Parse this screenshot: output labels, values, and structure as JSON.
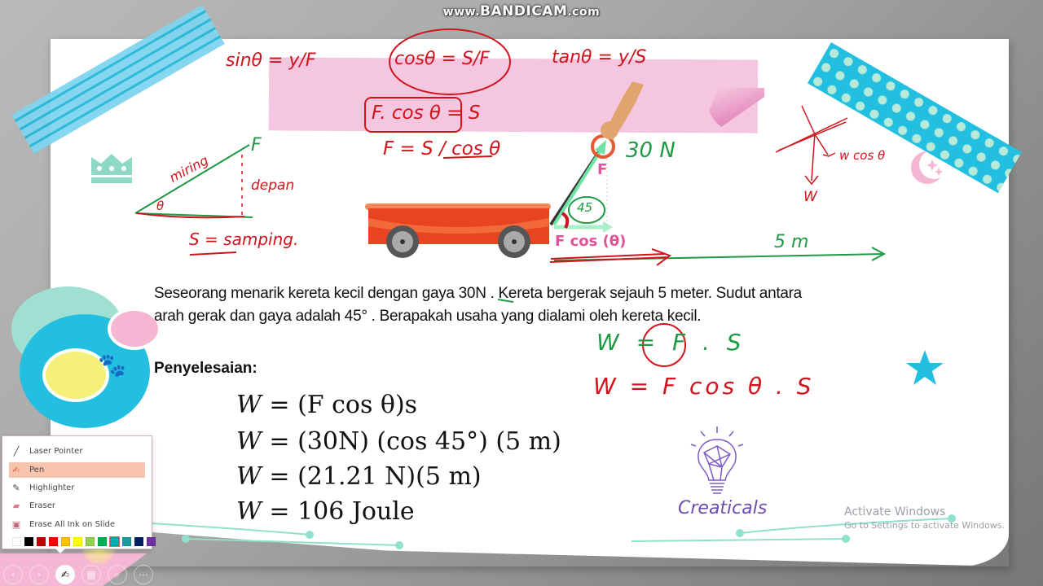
{
  "recorder": {
    "watermark_prefix": "www.",
    "watermark_brand": "BANDICAM",
    "watermark_suffix": ".com"
  },
  "slide": {
    "problem_text": "Seseorang menarik kereta kecil dengan gaya 30N . Kereta bergerak sejauh 5 meter. Sudut antara arah gerak dan gaya adalah 45° . Berapakah usaha yang dialami oleh kereta kecil.",
    "solution_heading": "Penyelesaian:",
    "equations": [
      {
        "lhs": "W",
        "rhs": "(F cos θ)s"
      },
      {
        "lhs": "W",
        "rhs": "(30N) (cos 45°) (5 m)"
      },
      {
        "lhs": "W",
        "rhs": "(21.21 N)(5 m)"
      },
      {
        "lhs": "W",
        "rhs": "106 Joule"
      }
    ],
    "diagram_labels": {
      "force": "F",
      "force_component": "F cos (θ)"
    },
    "brand": "Creaticals"
  },
  "ink_annotations": {
    "sin": "sinθ = y/F",
    "cos": "cosθ = S/F",
    "tan": "tanθ = y/S",
    "f_cos": "F. cos θ = S",
    "f_eq": "F = S / cos θ",
    "force_value": "30 N",
    "angle_value": "45",
    "distance": "5 m",
    "triangle_hyp": "miring",
    "triangle_opp": "depan",
    "triangle_adj": "S = samping.",
    "triangle_theta": "θ",
    "triangle_F": "F",
    "work1": "W = F . S",
    "work2": "W = F cos θ . S",
    "weight": "W",
    "weight_comp": "w cos θ"
  },
  "os_notice": {
    "title": "Activate Windows",
    "subtitle": "Go to Settings to activate Windows."
  },
  "ink_menu": {
    "items": [
      {
        "label": "Laser Pointer",
        "icon": "laser-pointer-icon",
        "selected": false
      },
      {
        "label": "Pen",
        "icon": "pen-icon",
        "selected": true
      },
      {
        "label": "Highlighter",
        "icon": "highlighter-icon",
        "selected": false
      },
      {
        "label": "Eraser",
        "icon": "eraser-icon",
        "selected": false
      },
      {
        "label": "Erase All Ink on Slide",
        "icon": "erase-all-icon",
        "selected": false
      }
    ],
    "colors": [
      "#ffffff",
      "#000000",
      "#c00000",
      "#ff0000",
      "#ffc000",
      "#ffff00",
      "#92d050",
      "#00b050",
      "#00b0b0",
      "#1a9c9c",
      "#002060",
      "#7030a0"
    ],
    "selected_color_index": 8
  },
  "slideshow_toolbar": {
    "buttons": [
      "previous",
      "next",
      "pen",
      "slides",
      "zoom",
      "more"
    ]
  }
}
